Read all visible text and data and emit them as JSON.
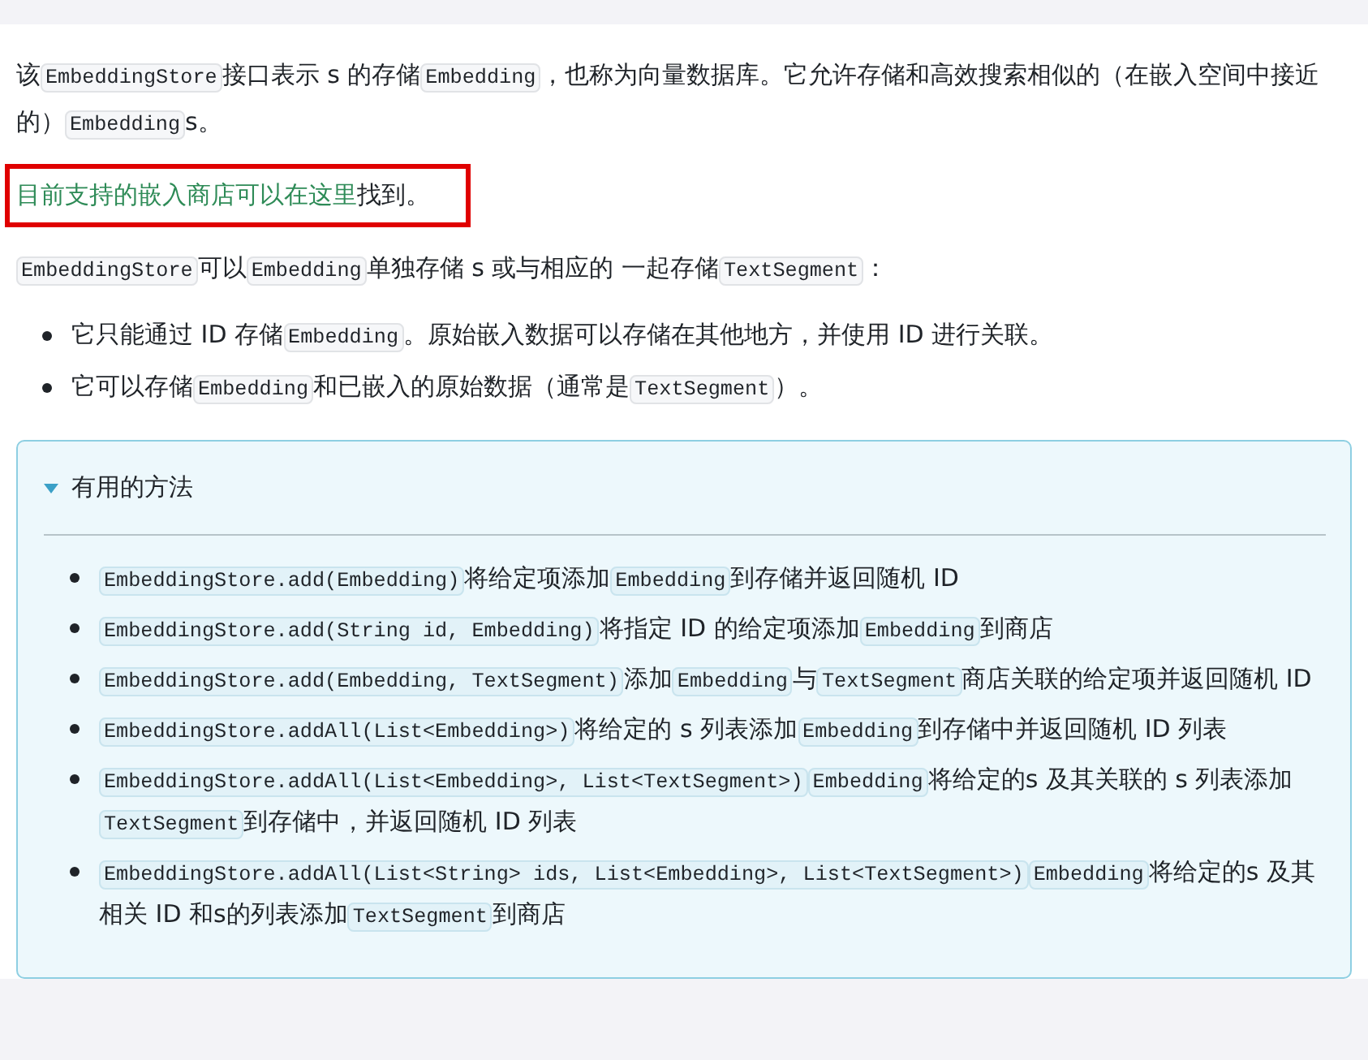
{
  "paragraphs": [
    {
      "highlighted": false,
      "parts": [
        {
          "kind": "text",
          "text": "该"
        },
        {
          "kind": "code",
          "text": "EmbeddingStore"
        },
        {
          "kind": "text",
          "text": "接口表示 s 的存储"
        },
        {
          "kind": "code",
          "text": "Embedding"
        },
        {
          "kind": "text",
          "text": "，也称为向量数据库。它允许存储和高效搜索相似的（在嵌入空间中接近的）"
        },
        {
          "kind": "code",
          "text": "Embedding"
        },
        {
          "kind": "text",
          "text": "s。"
        }
      ]
    },
    {
      "highlighted": true,
      "parts": [
        {
          "kind": "link",
          "text": "目前支持的嵌入商店可以在这里"
        },
        {
          "kind": "text",
          "text": "找到。"
        }
      ]
    },
    {
      "highlighted": false,
      "parts": [
        {
          "kind": "code",
          "text": "EmbeddingStore"
        },
        {
          "kind": "text",
          "text": "可以"
        },
        {
          "kind": "code",
          "text": "Embedding"
        },
        {
          "kind": "text",
          "text": "单独存储 s 或与相应的 一起存储"
        },
        {
          "kind": "code",
          "text": "TextSegment"
        },
        {
          "kind": "text",
          "text": "："
        }
      ]
    }
  ],
  "bullets": [
    [
      {
        "kind": "text",
        "text": "它只能通过 ID 存储"
      },
      {
        "kind": "code",
        "text": "Embedding"
      },
      {
        "kind": "text",
        "text": "。原始嵌入数据可以存储在其他地方，并使用 ID 进行关联。"
      }
    ],
    [
      {
        "kind": "text",
        "text": "它可以存储"
      },
      {
        "kind": "code",
        "text": "Embedding"
      },
      {
        "kind": "text",
        "text": "和已嵌入的原始数据（通常是"
      },
      {
        "kind": "code",
        "text": "TextSegment"
      },
      {
        "kind": "text",
        "text": "）。"
      }
    ]
  ],
  "details": {
    "summary": "有用的方法",
    "expanded": true,
    "items": [
      [
        {
          "kind": "code",
          "text": "EmbeddingStore.add(Embedding)"
        },
        {
          "kind": "text",
          "text": "将给定项添加"
        },
        {
          "kind": "code",
          "text": "Embedding"
        },
        {
          "kind": "text",
          "text": "到存储并返回随机 ID"
        }
      ],
      [
        {
          "kind": "code",
          "text": "EmbeddingStore.add(String id, Embedding)"
        },
        {
          "kind": "text",
          "text": "将指定 ID 的给定项添加"
        },
        {
          "kind": "code",
          "text": "Embedding"
        },
        {
          "kind": "text",
          "text": "到商店"
        }
      ],
      [
        {
          "kind": "code",
          "text": "EmbeddingStore.add(Embedding, TextSegment)"
        },
        {
          "kind": "text",
          "text": "添加"
        },
        {
          "kind": "code",
          "text": "Embedding"
        },
        {
          "kind": "text",
          "text": "与"
        },
        {
          "kind": "code",
          "text": "TextSegment"
        },
        {
          "kind": "text",
          "text": "商店关联的给定项并返回随机 ID"
        }
      ],
      [
        {
          "kind": "code",
          "text": "EmbeddingStore.addAll(List<Embedding>)"
        },
        {
          "kind": "text",
          "text": "将给定的 s 列表添加"
        },
        {
          "kind": "code",
          "text": "Embedding"
        },
        {
          "kind": "text",
          "text": "到存储中并返回随机 ID 列表"
        }
      ],
      [
        {
          "kind": "code",
          "text": "EmbeddingStore.addAll(List<Embedding>, List<TextSegment>)"
        },
        {
          "kind": "code",
          "text": "Embedding"
        },
        {
          "kind": "text",
          "text": "将给定的s 及其关联的 s 列表添加"
        },
        {
          "kind": "code",
          "text": "TextSegment"
        },
        {
          "kind": "text",
          "text": "到存储中，并返回随机 ID 列表"
        }
      ],
      [
        {
          "kind": "code",
          "text": "EmbeddingStore.addAll(List<String> ids, List<Embedding>, List<TextSegment>)"
        },
        {
          "kind": "code",
          "text": "Embedding"
        },
        {
          "kind": "text",
          "text": "将给定的s 及其相关 ID 和s的列表添加"
        },
        {
          "kind": "code",
          "text": "TextSegment"
        },
        {
          "kind": "text",
          "text": "到商店"
        }
      ]
    ]
  }
}
